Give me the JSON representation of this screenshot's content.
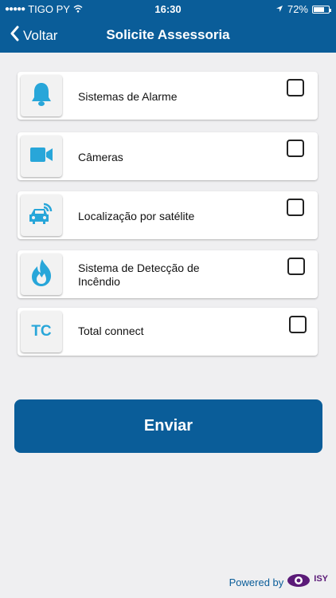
{
  "status": {
    "carrier": "TIGO PY",
    "time": "16:30",
    "battery": "72%",
    "battery_level": 0.72
  },
  "nav": {
    "back_label": "Voltar",
    "title": "Solicite Assessoria"
  },
  "items": [
    {
      "label": "Sistemas de Alarme",
      "icon": "bell-icon",
      "checked": false
    },
    {
      "label": "Câmeras",
      "icon": "video-camera-icon",
      "checked": false
    },
    {
      "label": "Localização por satélite",
      "icon": "car-satellite-icon",
      "checked": false
    },
    {
      "label": "Sistema de Detecção de Incêndio",
      "icon": "fire-icon",
      "checked": false
    },
    {
      "label": "Total connect",
      "icon": "tc-icon",
      "icon_text": "TC",
      "checked": false
    }
  ],
  "send_button": {
    "label": "Enviar"
  },
  "footer": {
    "powered_by": "Powered by",
    "brand": "ISY"
  },
  "colors": {
    "primary": "#0a5d99",
    "icon": "#28a6d9",
    "background": "#efeff1"
  }
}
